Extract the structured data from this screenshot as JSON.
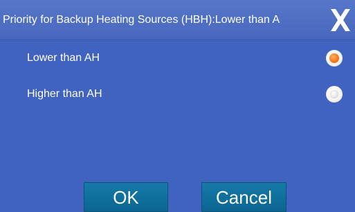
{
  "dialog": {
    "title": "Priority for Backup Heating Sources (HBH):Lower than A",
    "close_icon": "close-x-icon",
    "options": [
      {
        "label": "Lower than AH",
        "selected": true
      },
      {
        "label": "Higher than AH",
        "selected": false
      }
    ],
    "ok_label": "OK",
    "cancel_label": "Cancel"
  },
  "colors": {
    "background": "#3f63be",
    "title_bar": "#4e6fc2",
    "button": "#0e6f9c",
    "radio_selected": "#f47a1e",
    "text": "#ffffff"
  }
}
